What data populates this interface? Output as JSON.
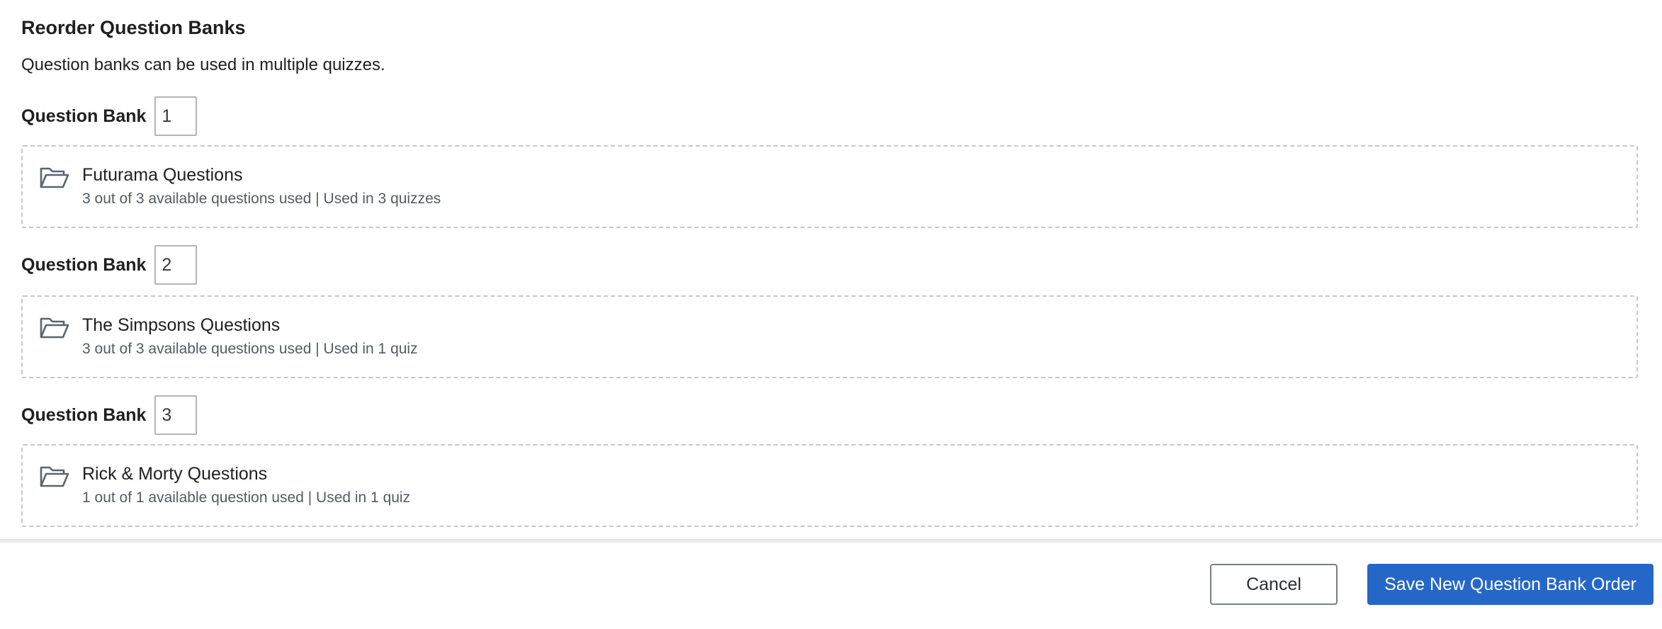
{
  "header": {
    "title": "Reorder Question Banks",
    "description": "Question banks can be used in multiple quizzes."
  },
  "banks": [
    {
      "label": "Question Bank",
      "order": "1",
      "name": "Futurama Questions",
      "meta": "3 out of 3 available questions used | Used in 3 quizzes",
      "icon": "folder-open-icon"
    },
    {
      "label": "Question Bank",
      "order": "2",
      "name": "The Simpsons Questions",
      "meta": "3 out of 3 available questions used | Used in 1 quiz",
      "icon": "folder-open-icon"
    },
    {
      "label": "Question Bank",
      "order": "3",
      "name": "Rick & Morty Questions",
      "meta": "1 out of 1 available question used | Used in 1 quiz",
      "icon": "folder-open-icon"
    }
  ],
  "footer": {
    "cancel_label": "Cancel",
    "save_label": "Save New Question Bank Order"
  },
  "colors": {
    "primary": "#2567c9",
    "icon": "#5a6472",
    "meta_text": "#545b64",
    "dashed_border": "#c8c8c8"
  }
}
